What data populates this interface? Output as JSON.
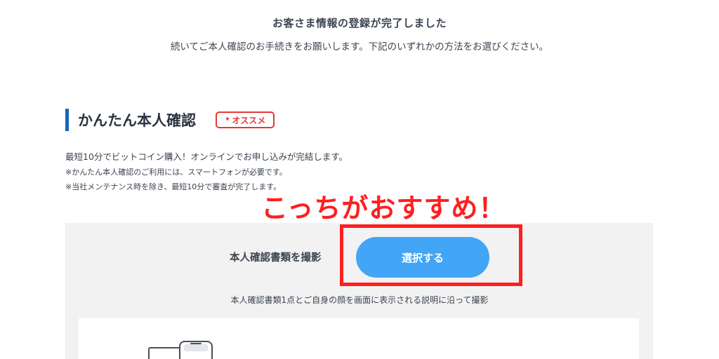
{
  "header": {
    "title": "お客さま情報の登録が完了しました",
    "subtitle": "続いてご本人確認のお手続きをお願いします。下記のいずれかの方法をお選びください。"
  },
  "section": {
    "title": "かんたん本人確認",
    "badge": "オススメ",
    "description": "最短10分でビットコイン購入！オンラインでお申し込みが完結します。",
    "notes": [
      "※かんたん本人確認のご利用には、スマートフォンが必要です。",
      "※当社メンテナンス時を除き、最短10分で審査が完了します。"
    ]
  },
  "upload": {
    "label": "本人確認書類を撮影",
    "button": "選択する",
    "description": "本人確認書類1点とご自身の顔を画面に表示される説明に沿って撮影"
  },
  "annotation": {
    "text": "こっちがおすすめ！"
  },
  "colors": {
    "accent_blue": "#1565c0",
    "button_blue": "#42a5f5",
    "badge_red": "#e53935",
    "annotation_red": "#ff1f1f",
    "panel_gray": "#f2f2f2"
  },
  "icons": {
    "badge_icon": "sparkle-icon",
    "illustration": "phone-id-card-illustration"
  }
}
